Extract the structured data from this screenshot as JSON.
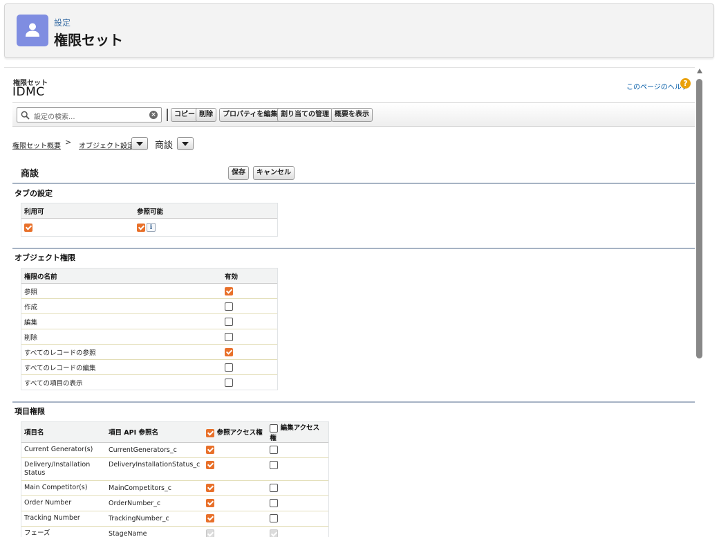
{
  "header": {
    "subtitle": "設定",
    "title": "権限セット"
  },
  "page": {
    "small_label": "権限セット",
    "name": "IDMC",
    "help_link": "このページのヘルプ",
    "help_icon": "?"
  },
  "toolbar": {
    "search_placeholder": "設定の検索...",
    "buttons": [
      "コピー",
      "削除",
      "プロパティを編集",
      "割り当ての管理",
      "概要を表示"
    ]
  },
  "breadcrumb": {
    "overview": "権限セット概要",
    "separator": ">",
    "object_settings": "オブジェクト設定",
    "current": "商談"
  },
  "object": {
    "title": "商談",
    "save_label": "保存",
    "cancel_label": "キャンセル"
  },
  "tab_settings": {
    "title": "タブの設定",
    "headers": [
      "利用可",
      "参照可能"
    ],
    "available": true,
    "visible": true,
    "info_icon": "i"
  },
  "object_permissions": {
    "title": "オブジェクト権限",
    "headers": [
      "権限の名前",
      "有効"
    ],
    "rows": [
      {
        "name": "参照",
        "enabled": true
      },
      {
        "name": "作成",
        "enabled": false
      },
      {
        "name": "編集",
        "enabled": false
      },
      {
        "name": "削除",
        "enabled": false
      },
      {
        "name": "すべてのレコードの参照",
        "enabled": true
      },
      {
        "name": "すべてのレコードの編集",
        "enabled": false
      },
      {
        "name": "すべての項目の表示",
        "enabled": false
      }
    ]
  },
  "field_permissions": {
    "title": "項目権限",
    "headers": [
      "項目名",
      "項目 API 参照名",
      "参照アクセス権",
      "編集アクセス権"
    ],
    "header_read_checked": true,
    "header_edit_checked": false,
    "rows": [
      {
        "label": "Current Generator(s)",
        "api": "CurrentGenerators_c",
        "read": "on",
        "edit": "off"
      },
      {
        "label": "Delivery/Installation Status",
        "api": "DeliveryInstallationStatus_c",
        "read": "on",
        "edit": "off"
      },
      {
        "label": "Main Competitor(s)",
        "api": "MainCompetitors_c",
        "read": "on",
        "edit": "off"
      },
      {
        "label": "Order Number",
        "api": "OrderNumber_c",
        "read": "on",
        "edit": "off"
      },
      {
        "label": "Tracking Number",
        "api": "TrackingNumber_c",
        "read": "on",
        "edit": "off"
      },
      {
        "label": "フェーズ",
        "api": "StageName",
        "read": "dis",
        "edit": "dis"
      }
    ]
  }
}
